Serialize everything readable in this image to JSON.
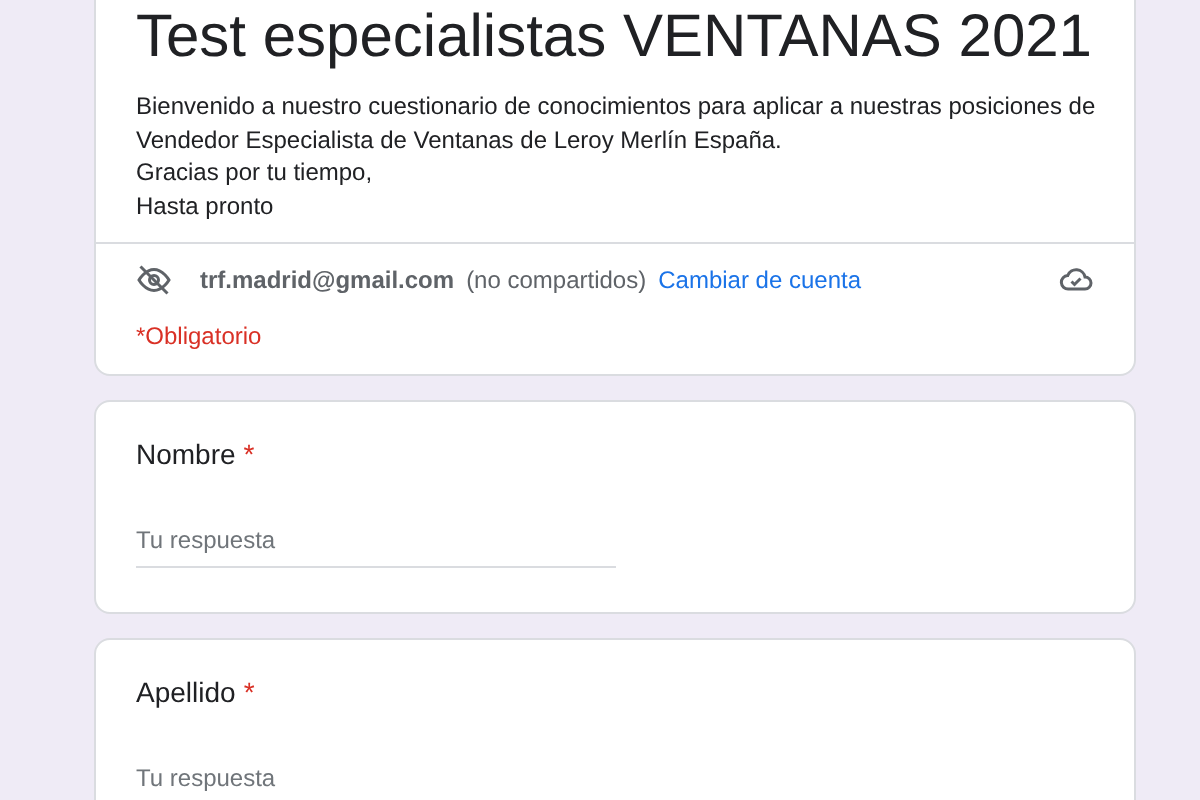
{
  "form": {
    "title": "Test especialistas VENTANAS 2021",
    "description": [
      "Bienvenido a nuestro cuestionario de conocimientos para aplicar a nuestras posiciones de",
      "Vendedor Especialista de Ventanas de Leroy Merlín España.",
      "Gracias por tu tiempo,",
      "Hasta pronto"
    ],
    "account": {
      "email": "trf.madrid@gmail.com",
      "note": "(no compartidos)",
      "switch_link": "Cambiar de cuenta"
    },
    "required_note": "*Obligatorio"
  },
  "questions": [
    {
      "label": "Nombre",
      "required": true,
      "required_mark": "*",
      "placeholder": "Tu respuesta"
    },
    {
      "label": "Apellido",
      "required": true,
      "required_mark": "*",
      "placeholder": "Tu respuesta"
    }
  ]
}
